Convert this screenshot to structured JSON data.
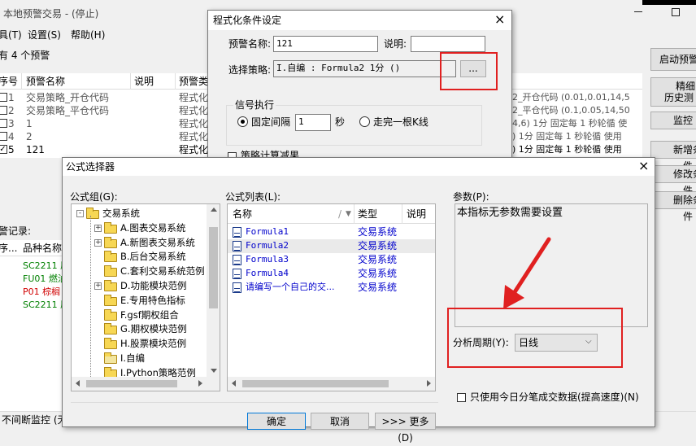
{
  "main_window": {
    "title": "本地预警交易 - (停止)",
    "menu": [
      "具(T)",
      "设置(S)",
      "帮助(H)"
    ],
    "count_label": "有 4 个预警",
    "columns": [
      "序号",
      "预警名称",
      "说明",
      "预警类"
    ],
    "rows": [
      {
        "no": "1",
        "name": "交易策略_开仓代码",
        "type": "程式化",
        "extra": "2_开仓代码 (0.01,0.01,14,5"
      },
      {
        "no": "2",
        "name": "交易策略_平仓代码",
        "type": "程式化",
        "extra": "2_平仓代码 (0.1,0.05,14,50"
      },
      {
        "no": "3",
        "name": "1",
        "type": "程式化",
        "extra": "4,6) 1分 固定每 1 秒轮循 使"
      },
      {
        "no": "4",
        "name": "2",
        "type": "程式化",
        "extra": ") 1分 固定每 1 秒轮循 使用"
      },
      {
        "no": "5",
        "name": "121",
        "type": "程式化",
        "extra": ") 1分 固定每 1 秒轮循 使用"
      }
    ],
    "right_buttons": [
      "启动预警",
      "精细",
      "历史测",
      "监控",
      "新增条件",
      "修改条件",
      "删除条件"
    ],
    "records_label": "警记录:",
    "records_columns": [
      "序...",
      "品种名称"
    ],
    "records": [
      {
        "text": "SC2211 原",
        "color": "#008000"
      },
      {
        "text": "FU01 燃油",
        "color": "#008000"
      },
      {
        "text": "P01 棕榈",
        "color": "#d00000"
      },
      {
        "text": "SC2211 原",
        "color": "#008000"
      }
    ],
    "status": "不间断监控 (无"
  },
  "condition_dialog": {
    "title": "程式化条件设定",
    "name_label": "预警名称:",
    "name_value": "121",
    "desc_label": "说明:",
    "desc_value": "",
    "strategy_label": "选择策略:",
    "strategy_value": "I.自编 : Formula2 1分 ()",
    "browse_label": "...",
    "group_label": "信号执行",
    "fixed_label": "固定间隔",
    "interval_value": "1",
    "seconds_label": "秒",
    "kline_label": "走完一根K线",
    "partial_checkbox": "策略计算减果"
  },
  "formula_dialog": {
    "title": "公式选择器",
    "close_icon": "×",
    "group_label": "公式组(G):",
    "tree": [
      {
        "label": "交易系统",
        "level": 0,
        "expander": "-"
      },
      {
        "label": "A.图表交易系统",
        "level": 1,
        "expander": "+"
      },
      {
        "label": "A.新图表交易系统",
        "level": 1,
        "expander": "+"
      },
      {
        "label": "B.后台交易系统",
        "level": 1,
        "expander": ""
      },
      {
        "label": "C.套利交易系统范例",
        "level": 1,
        "expander": ""
      },
      {
        "label": "D.功能模块范例",
        "level": 1,
        "expander": "+"
      },
      {
        "label": "E.专用特色指标",
        "level": 1,
        "expander": ""
      },
      {
        "label": "F.gsf期权组合",
        "level": 1,
        "expander": ""
      },
      {
        "label": "G.期权模块范例",
        "level": 1,
        "expander": ""
      },
      {
        "label": "H.股票模块范例",
        "level": 1,
        "expander": ""
      },
      {
        "label": "I.自编",
        "level": 1,
        "expander": ""
      },
      {
        "label": "I.Python策略范例",
        "level": 1,
        "expander": ""
      }
    ],
    "list_label": "公式列表(L):",
    "list_columns": [
      "名称",
      "类型",
      "说明"
    ],
    "list_rows": [
      {
        "name": "Formula1",
        "type": "交易系统"
      },
      {
        "name": "Formula2",
        "type": "交易系统"
      },
      {
        "name": "Formula3",
        "type": "交易系统"
      },
      {
        "name": "Formula4",
        "type": "交易系统"
      },
      {
        "name": "请编写一个自己的交...",
        "type": "交易系统"
      }
    ],
    "params_label": "参数(P):",
    "params_text": "本指标无参数需要设置",
    "period_label": "分析周期(Y):",
    "period_value": "日线",
    "only_today_label": "只使用今日分笔成交数据(提高速度)(N)",
    "ok_label": "确定",
    "cancel_label": "取消",
    "more_label": ">>> 更多(D)"
  },
  "colors": {
    "annotation_red": "#e02020",
    "link_blue": "#0000cc",
    "folder_yellow": "#f7d754"
  }
}
